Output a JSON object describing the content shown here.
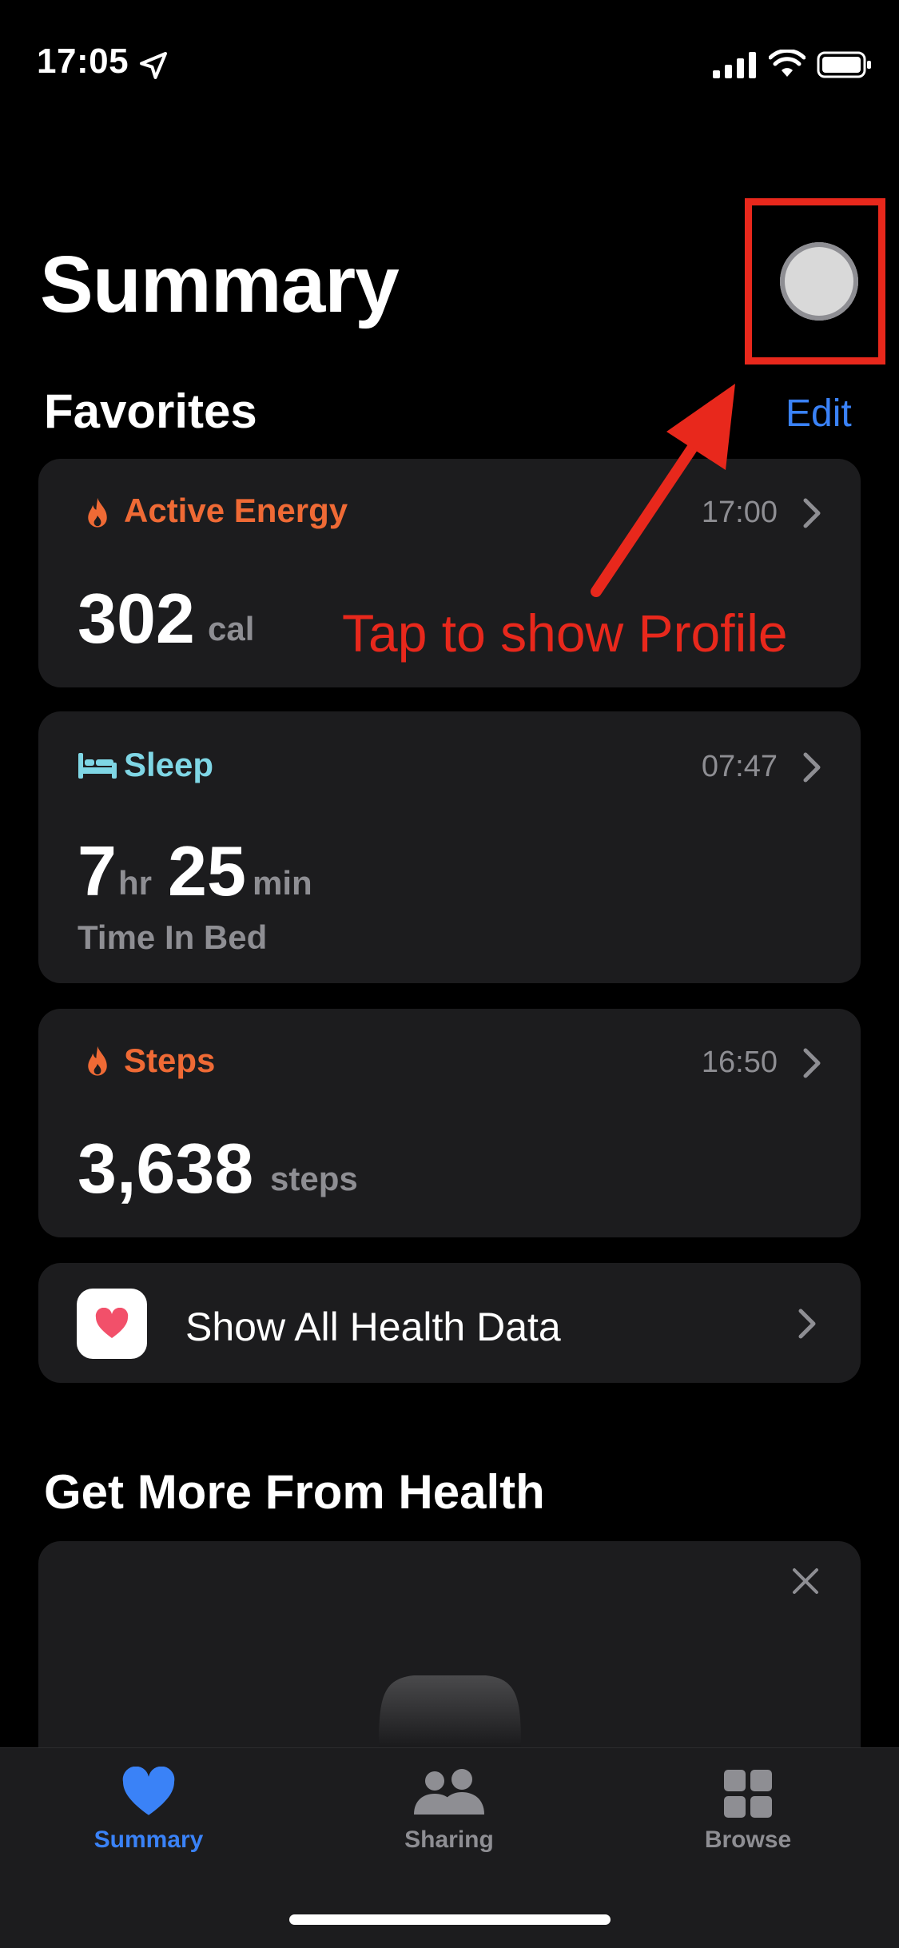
{
  "status_bar": {
    "time": "17:05"
  },
  "header": {
    "title": "Summary"
  },
  "favorites": {
    "title": "Favorites",
    "edit_label": "Edit",
    "cards": [
      {
        "title": "Active Energy",
        "time": "17:00",
        "value": "302",
        "unit": "cal",
        "icon": "flame-icon",
        "color": "#ef6a35"
      },
      {
        "title": "Sleep",
        "time": "07:47",
        "value_hours": "7",
        "unit_hours": "hr",
        "value_minutes": "25",
        "unit_minutes": "min",
        "subtitle": "Time In Bed",
        "icon": "bed-icon",
        "color": "#7fd6e5"
      },
      {
        "title": "Steps",
        "time": "16:50",
        "value": "3,638",
        "unit": "steps",
        "icon": "flame-icon",
        "color": "#ef6a35"
      }
    ],
    "show_all_label": "Show All Health Data"
  },
  "annotation": {
    "text": "Tap to show Profile",
    "color": "#e8281c"
  },
  "get_more": {
    "title": "Get More From Health"
  },
  "tab_bar": {
    "tabs": [
      {
        "label": "Summary",
        "icon": "heart-icon",
        "active": true
      },
      {
        "label": "Sharing",
        "icon": "people-icon",
        "active": false
      },
      {
        "label": "Browse",
        "icon": "grid-icon",
        "active": false
      }
    ]
  },
  "colors": {
    "accent": "#3a82f7",
    "background": "#000000",
    "card": "#1c1c1e"
  }
}
